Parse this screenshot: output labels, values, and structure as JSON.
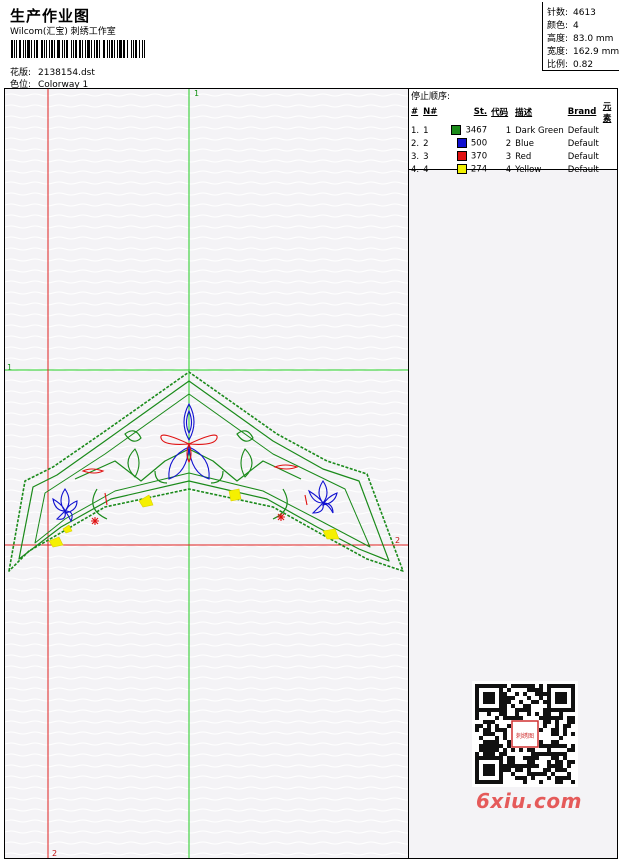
{
  "header": {
    "title": "生产作业图",
    "studio": "Wilcom(汇宝) 刺绣工作室",
    "design_label": "花版:",
    "design_file": "2138154.dst",
    "colorway_label": "色位:",
    "colorway": "Colorway 1"
  },
  "stats": {
    "stitches_label": "针数:",
    "stitches": "4613",
    "colors_label": "颜色:",
    "colors": "4",
    "height_label": "高度:",
    "height": "83.0 mm",
    "width_label": "宽度:",
    "width": "162.9 mm",
    "scale_label": "比例:",
    "scale": "0.82"
  },
  "stop_sequence": {
    "title": "停止顺序:",
    "columns": [
      "#",
      "N#",
      "St.",
      "代码",
      "描述",
      "Brand",
      "元素"
    ],
    "rows": [
      {
        "idx": "1.",
        "n": "1",
        "color": "#1a8a1a",
        "st": "3467",
        "code": "1",
        "desc": "Dark Green",
        "brand": "Default"
      },
      {
        "idx": "2.",
        "n": "2",
        "color": "#1010d0",
        "st": "500",
        "code": "2",
        "desc": "Blue",
        "brand": "Default"
      },
      {
        "idx": "3.",
        "n": "3",
        "color": "#e01010",
        "st": "370",
        "code": "3",
        "desc": "Red",
        "brand": "Default"
      },
      {
        "idx": "4.",
        "n": "4",
        "color": "#f0f000",
        "st": "274",
        "code": "4",
        "desc": "Yellow",
        "brand": "Default"
      }
    ]
  },
  "guides": {
    "green_v": "1",
    "green_h": "1",
    "red_h": "2",
    "red_v": "2"
  },
  "watermark": "6xiu.com",
  "qr_badge": "刺绣图"
}
